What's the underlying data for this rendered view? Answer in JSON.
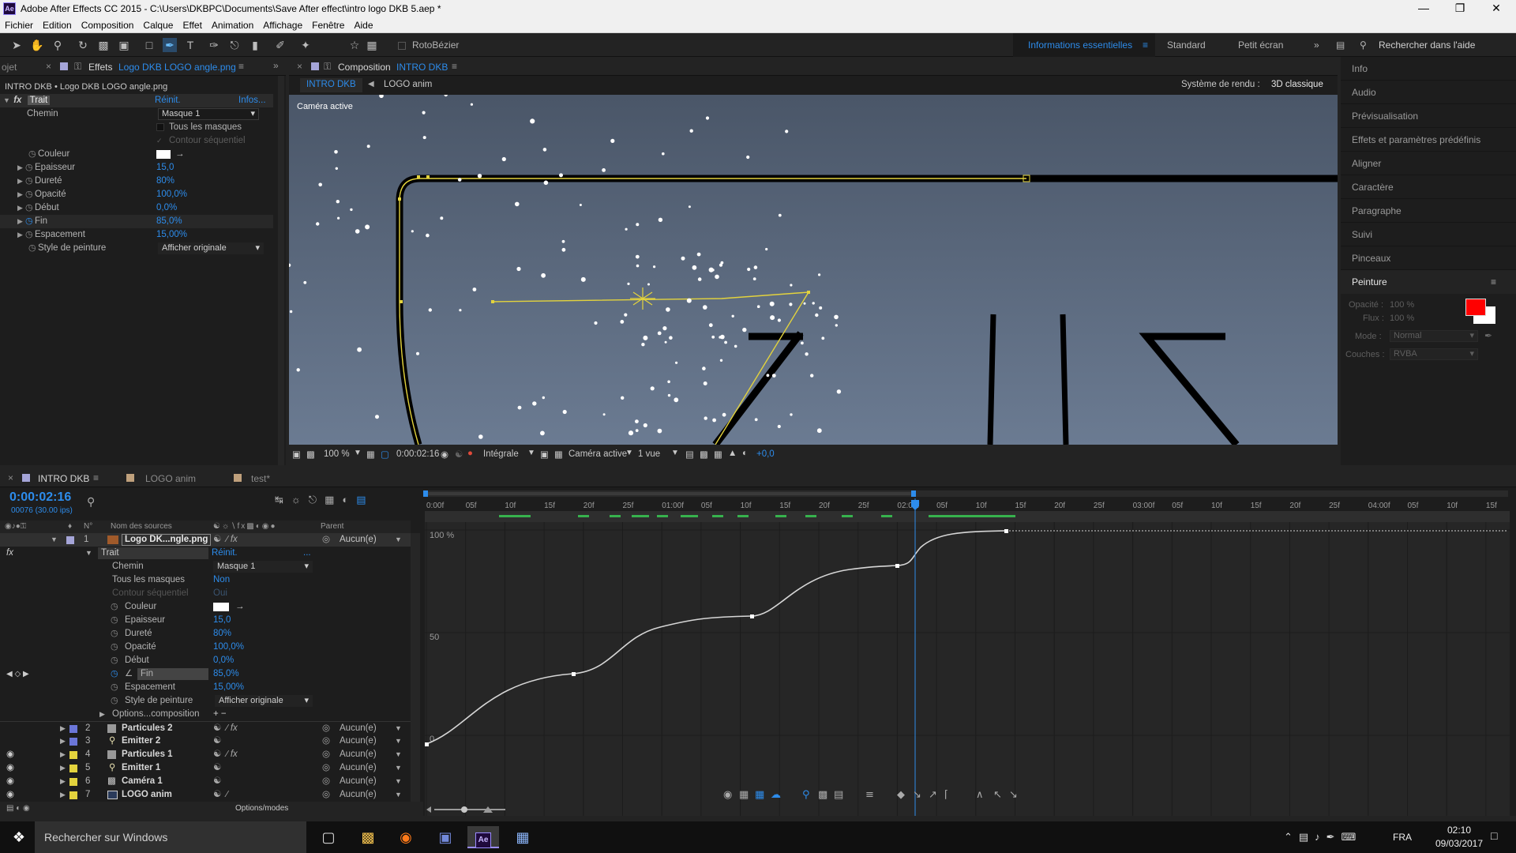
{
  "window": {
    "title": "Adobe After Effects CC 2015 - C:\\Users\\DKBPC\\Documents\\Save After effect\\intro logo DKB 5.aep *",
    "app_icon": "Ae"
  },
  "menu": [
    "Fichier",
    "Edition",
    "Composition",
    "Calque",
    "Effet",
    "Animation",
    "Affichage",
    "Fenêtre",
    "Aide"
  ],
  "toolbar": {
    "rotobezier": "RotoBézier",
    "workspaces": [
      "Informations essentielles",
      "Standard",
      "Petit écran"
    ],
    "active_workspace_color": "#2d8ceb",
    "search_help": "Rechercher dans l'aide"
  },
  "effects_panel": {
    "tab_project": "ojet",
    "tab_label": "Effets",
    "tab_file": "Logo DKB LOGO angle.png",
    "breadcrumb": "INTRO DKB • Logo DKB LOGO angle.png",
    "effect_name": "Trait",
    "reset": "Réinit.",
    "info": "Infos...",
    "props": [
      {
        "label": "Chemin",
        "value": "Masque 1",
        "type": "dropdown"
      },
      {
        "label": "",
        "value": "Tous les masques",
        "type": "checkbox"
      },
      {
        "label": "",
        "value": "Contour séquentiel",
        "type": "checkbox-disabled"
      },
      {
        "label": "Couleur",
        "value": "",
        "type": "color"
      },
      {
        "label": "Epaisseur",
        "value": "15,0",
        "type": "num"
      },
      {
        "label": "Dureté",
        "value": "80%",
        "type": "num"
      },
      {
        "label": "Opacité",
        "value": "100,0%",
        "type": "num"
      },
      {
        "label": "Début",
        "value": "0,0%",
        "type": "num"
      },
      {
        "label": "Fin",
        "value": "85,0%",
        "type": "num"
      },
      {
        "label": "Espacement",
        "value": "15,00%",
        "type": "num"
      },
      {
        "label": "Style de peinture",
        "value": "Afficher originale",
        "type": "dropdown"
      }
    ]
  },
  "composition": {
    "tab_label": "Composition",
    "tab_comp": "INTRO DKB",
    "crumb1": "INTRO DKB",
    "crumb2": "LOGO anim",
    "renderer_label": "Système de rendu :",
    "renderer_value": "3D classique",
    "camera_label": "Caméra active",
    "bottom": {
      "zoom": "100 %",
      "timecode": "0:00:02:16",
      "resolution": "Intégrale",
      "camera": "Caméra active",
      "views": "1 vue",
      "exposure": "+0,0"
    }
  },
  "right_panel": {
    "items": [
      "Info",
      "Audio",
      "Prévisualisation",
      "Effets et paramètres prédéfinis",
      "Aligner",
      "Caractère",
      "Paragraphe",
      "Suivi",
      "Pinceaux"
    ],
    "paint": {
      "title": "Peinture",
      "opacity_label": "Opacité :",
      "opacity_value": "100 %",
      "flow_label": "Flux :",
      "flow_value": "100 %",
      "mode_label": "Mode :",
      "mode_value": "Normal",
      "channels_label": "Couches :",
      "channels_value": "RVBA",
      "fg_color": "#ff0000",
      "bg_color": "#ffffff"
    }
  },
  "timeline": {
    "tabs": [
      "INTRO DKB",
      "LOGO anim",
      "test*"
    ],
    "timecode": "0:00:02:16",
    "frames": "00076 (30.00 ips)",
    "col_source": "Nom des sources",
    "col_num": "N°",
    "col_parent": "Parent",
    "ruler": [
      "0:00f",
      "05f",
      "10f",
      "15f",
      "20f",
      "25f",
      "01:00f",
      "05f",
      "10f",
      "15f",
      "20f",
      "25f",
      "02:00f",
      "05f",
      "10f",
      "15f",
      "20f",
      "25f",
      "03:00f",
      "05f",
      "10f",
      "15f",
      "20f",
      "25f",
      "04:00f",
      "05f",
      "10f",
      "15f"
    ],
    "graph_labels": [
      "100 %",
      "50",
      "0"
    ],
    "layer1": {
      "num": "1",
      "name": "Logo DK...ngle.png",
      "parent": "Aucun(e)"
    },
    "trait": {
      "label": "Trait",
      "reset": "Réinit.",
      "dots": "..."
    },
    "props": [
      {
        "label": "Chemin",
        "value": "Masque 1"
      },
      {
        "label": "Tous les masques",
        "value": "Non"
      },
      {
        "label": "Contour séquentiel",
        "value": "Oui"
      },
      {
        "label": "Couleur",
        "value": ""
      },
      {
        "label": "Epaisseur",
        "value": "15,0"
      },
      {
        "label": "Dureté",
        "value": "80%"
      },
      {
        "label": "Opacité",
        "value": "100,0%"
      },
      {
        "label": "Début",
        "value": "0,0%"
      },
      {
        "label": "Fin",
        "value": "85,0%"
      },
      {
        "label": "Espacement",
        "value": "15,00%"
      },
      {
        "label": "Style de peinture",
        "value": "Afficher originale"
      }
    ],
    "options_comp": "Options...composition",
    "layers": [
      {
        "num": "2",
        "name": "Particules 2",
        "color": "#6b76d8",
        "parent": "Aucun(e)"
      },
      {
        "num": "3",
        "name": "Emitter 2",
        "color": "#6b76d8",
        "parent": "Aucun(e)"
      },
      {
        "num": "4",
        "name": "Particules 1",
        "color": "#e3d33d",
        "parent": "Aucun(e)"
      },
      {
        "num": "5",
        "name": "Emitter 1",
        "color": "#e3d33d",
        "parent": "Aucun(e)"
      },
      {
        "num": "6",
        "name": "Caméra 1",
        "color": "#e3d33d",
        "parent": "Aucun(e)"
      },
      {
        "num": "7",
        "name": "LOGO anim",
        "color": "#e3d33d",
        "parent": "Aucun(e)"
      }
    ],
    "footer": "Options/modes"
  },
  "taskbar": {
    "search": "Rechercher sur Windows",
    "lang": "FRA",
    "time": "02:10",
    "date": "09/03/2017"
  }
}
